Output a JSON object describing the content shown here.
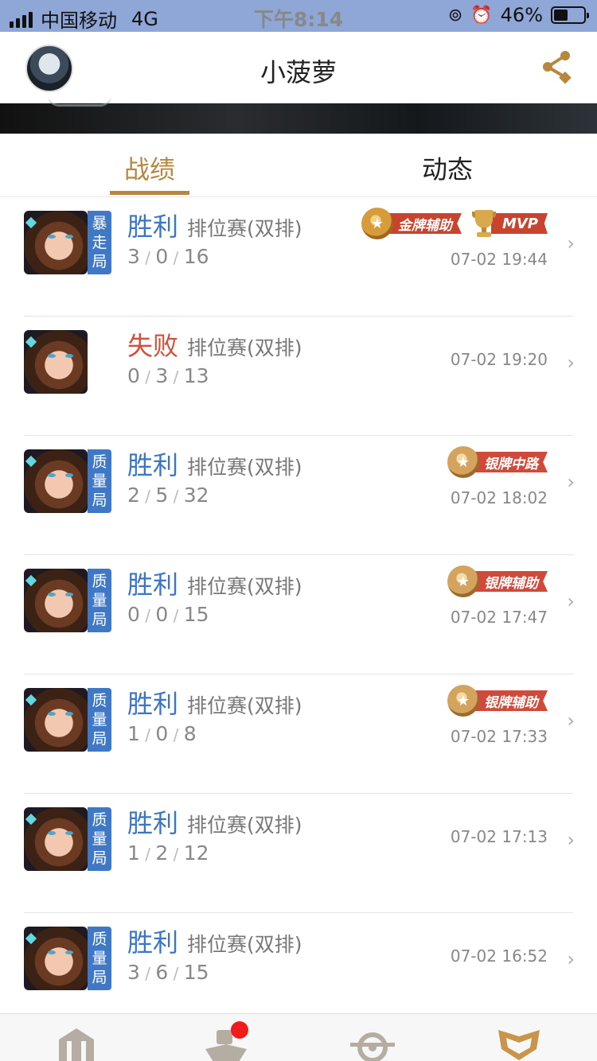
{
  "status_bar": {
    "carrier": "中国移动",
    "network": "4G",
    "time": "下午8:14",
    "battery": "46%",
    "battery_level": 0.46
  },
  "header": {
    "title": "小菠萝"
  },
  "tabs": [
    {
      "label": "战绩",
      "active": true
    },
    {
      "label": "动态",
      "active": false
    }
  ],
  "matches": [
    {
      "tag": "暴走局",
      "result": "胜利",
      "outcome": "win",
      "mode": "排位赛(双排)",
      "k": "3",
      "d": "0",
      "a": "16",
      "time": "07-02 19:44",
      "badge": "金牌辅助",
      "mvp": "MVP"
    },
    {
      "tag": "",
      "result": "失败",
      "outcome": "lose",
      "mode": "排位赛(双排)",
      "k": "0",
      "d": "3",
      "a": "13",
      "time": "07-02 19:20",
      "badge": "",
      "mvp": ""
    },
    {
      "tag": "质量局",
      "result": "胜利",
      "outcome": "win",
      "mode": "排位赛(双排)",
      "k": "2",
      "d": "5",
      "a": "32",
      "time": "07-02 18:02",
      "badge": "银牌中路",
      "mvp": ""
    },
    {
      "tag": "质量局",
      "result": "胜利",
      "outcome": "win",
      "mode": "排位赛(双排)",
      "k": "0",
      "d": "0",
      "a": "15",
      "time": "07-02 17:47",
      "badge": "银牌辅助",
      "mvp": ""
    },
    {
      "tag": "质量局",
      "result": "胜利",
      "outcome": "win",
      "mode": "排位赛(双排)",
      "k": "1",
      "d": "0",
      "a": "8",
      "time": "07-02 17:33",
      "badge": "银牌辅助",
      "mvp": ""
    },
    {
      "tag": "质量局",
      "result": "胜利",
      "outcome": "win",
      "mode": "排位赛(双排)",
      "k": "1",
      "d": "2",
      "a": "12",
      "time": "07-02 17:13",
      "badge": "",
      "mvp": ""
    },
    {
      "tag": "质量局",
      "result": "胜利",
      "outcome": "win",
      "mode": "排位赛(双排)",
      "k": "3",
      "d": "6",
      "a": "15",
      "time": "07-02 16:52",
      "badge": "",
      "mvp": ""
    }
  ],
  "colors": {
    "accent": "#b8873f",
    "win": "#3a76c6",
    "lose": "#d0503c",
    "tag_bg": "#3f78c4",
    "badge_red": "#c8442f"
  },
  "icons": {
    "share": "share-icon",
    "star": "★",
    "chevron": "›"
  },
  "bottom_nav": [
    {
      "name": "home-icon"
    },
    {
      "name": "friends-icon",
      "has_notification": true
    },
    {
      "name": "discover-icon"
    },
    {
      "name": "me-icon",
      "active": true
    }
  ]
}
